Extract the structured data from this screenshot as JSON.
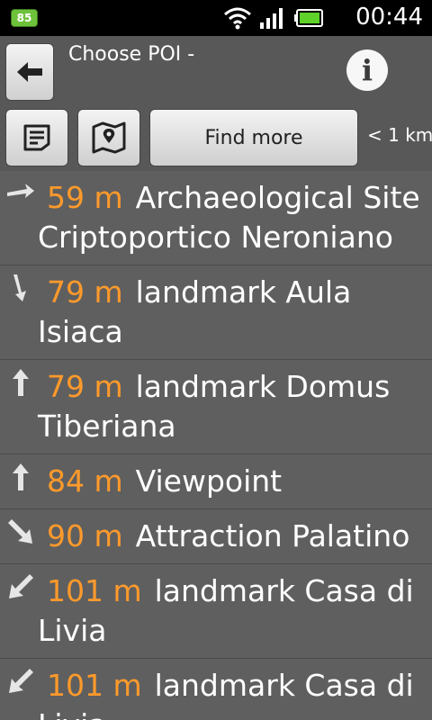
{
  "status_bar": {
    "battery_level": "85",
    "time": "00:44"
  },
  "header": {
    "title": "Choose POI -"
  },
  "toolbar": {
    "find_more_label": "Find more",
    "range_label": "< 1 km"
  },
  "poi_list": [
    {
      "direction": "right-arrow-icon",
      "distance": "59 m",
      "name": "Archaeological Site Criptoportico Neroniano"
    },
    {
      "direction": "down-arrow-icon",
      "distance": "79 m",
      "name": "landmark Aula Isiaca"
    },
    {
      "direction": "up-arrow-icon",
      "distance": "79 m",
      "name": "landmark Domus Tiberiana"
    },
    {
      "direction": "up-arrow-icon",
      "distance": "84 m",
      "name": "Viewpoint"
    },
    {
      "direction": "down-right-arrow-icon",
      "distance": "90 m",
      "name": "Attraction Palatino"
    },
    {
      "direction": "down-left-arrow-icon",
      "distance": "101 m",
      "name": "landmark Casa di Livia"
    },
    {
      "direction": "down-left-arrow-icon",
      "distance": "101 m",
      "name": "landmark Casa di Livia"
    }
  ],
  "colors": {
    "background": "#5f5f5f",
    "distance_accent": "#ff9a2b"
  }
}
